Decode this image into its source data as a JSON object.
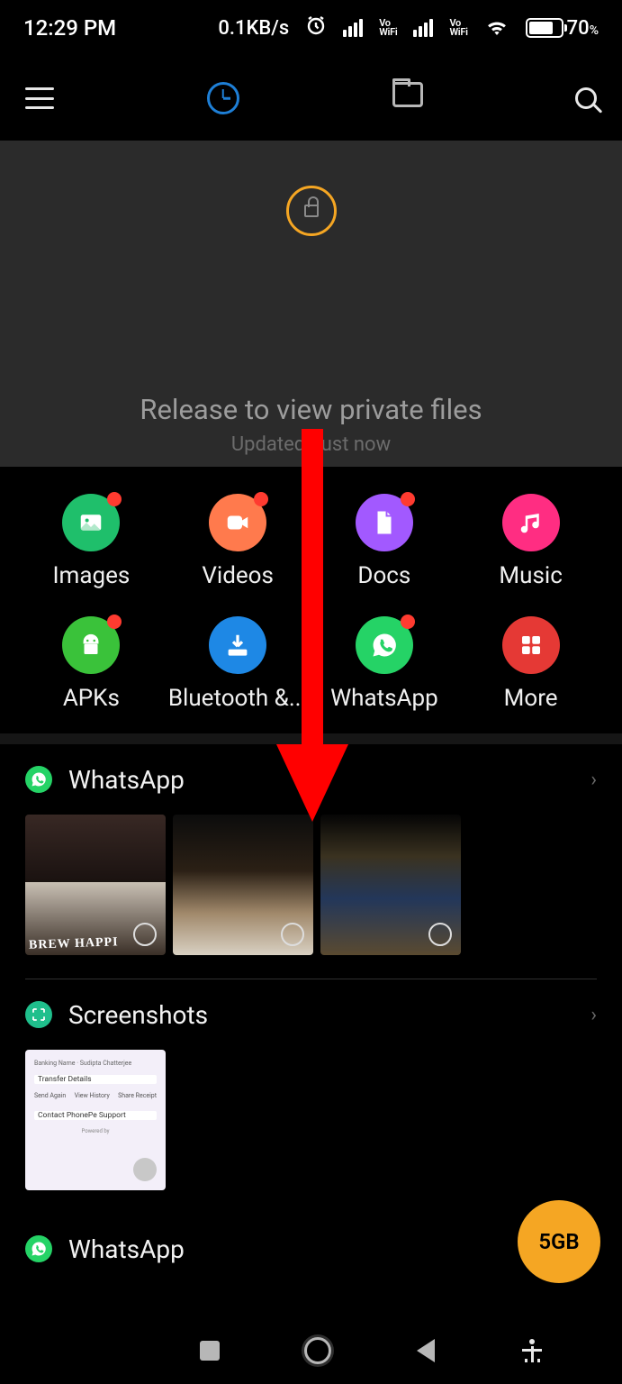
{
  "status": {
    "time": "12:29 PM",
    "net_speed": "0.1KB/s",
    "vowifi": "Vo\nWiFi",
    "battery_pct": "70",
    "battery_pct_suffix": "%"
  },
  "pull_panel": {
    "title": "Release to view private files",
    "subtitle": "Updated Just now"
  },
  "categories": [
    {
      "label": "Images",
      "color": "#1fbf6b",
      "has_dot": true,
      "icon": "image"
    },
    {
      "label": "Videos",
      "color": "#ff7a4d",
      "has_dot": true,
      "icon": "video"
    },
    {
      "label": "Docs",
      "color": "#a259ff",
      "has_dot": true,
      "icon": "doc"
    },
    {
      "label": "Music",
      "color": "#ff2d82",
      "has_dot": false,
      "icon": "music"
    },
    {
      "label": "APKs",
      "color": "#3ac23a",
      "has_dot": true,
      "icon": "android"
    },
    {
      "label": "Bluetooth &...",
      "color": "#1e88e5",
      "has_dot": false,
      "icon": "bt"
    },
    {
      "label": "WhatsApp",
      "color": "#25d366",
      "has_dot": true,
      "icon": "whatsapp"
    },
    {
      "label": "More",
      "color": "#e53935",
      "has_dot": false,
      "icon": "more"
    }
  ],
  "sections": [
    {
      "id": "whatsapp1",
      "title": "WhatsApp",
      "icon_color": "#25d366",
      "icon": "whatsapp",
      "thumbs": 3
    },
    {
      "id": "screenshots",
      "title": "Screenshots",
      "icon_color": "#1fbf8c",
      "icon": "screenshot",
      "thumbs": 1
    },
    {
      "id": "whatsapp2",
      "title": "WhatsApp",
      "icon_color": "#25d366",
      "icon": "whatsapp",
      "thumbs": 0
    }
  ],
  "screenshot_mock": {
    "line1": "Banking Name · Sudipta Chatterjee",
    "line2": "Transfer Details",
    "btn1": "Send Again",
    "btn2": "View History",
    "btn3": "Share Receipt",
    "line3": "Contact PhonePe Support",
    "footer": "Powered by"
  },
  "fab": {
    "label": "5GB"
  },
  "brew_text": "BREW  HAPPI"
}
